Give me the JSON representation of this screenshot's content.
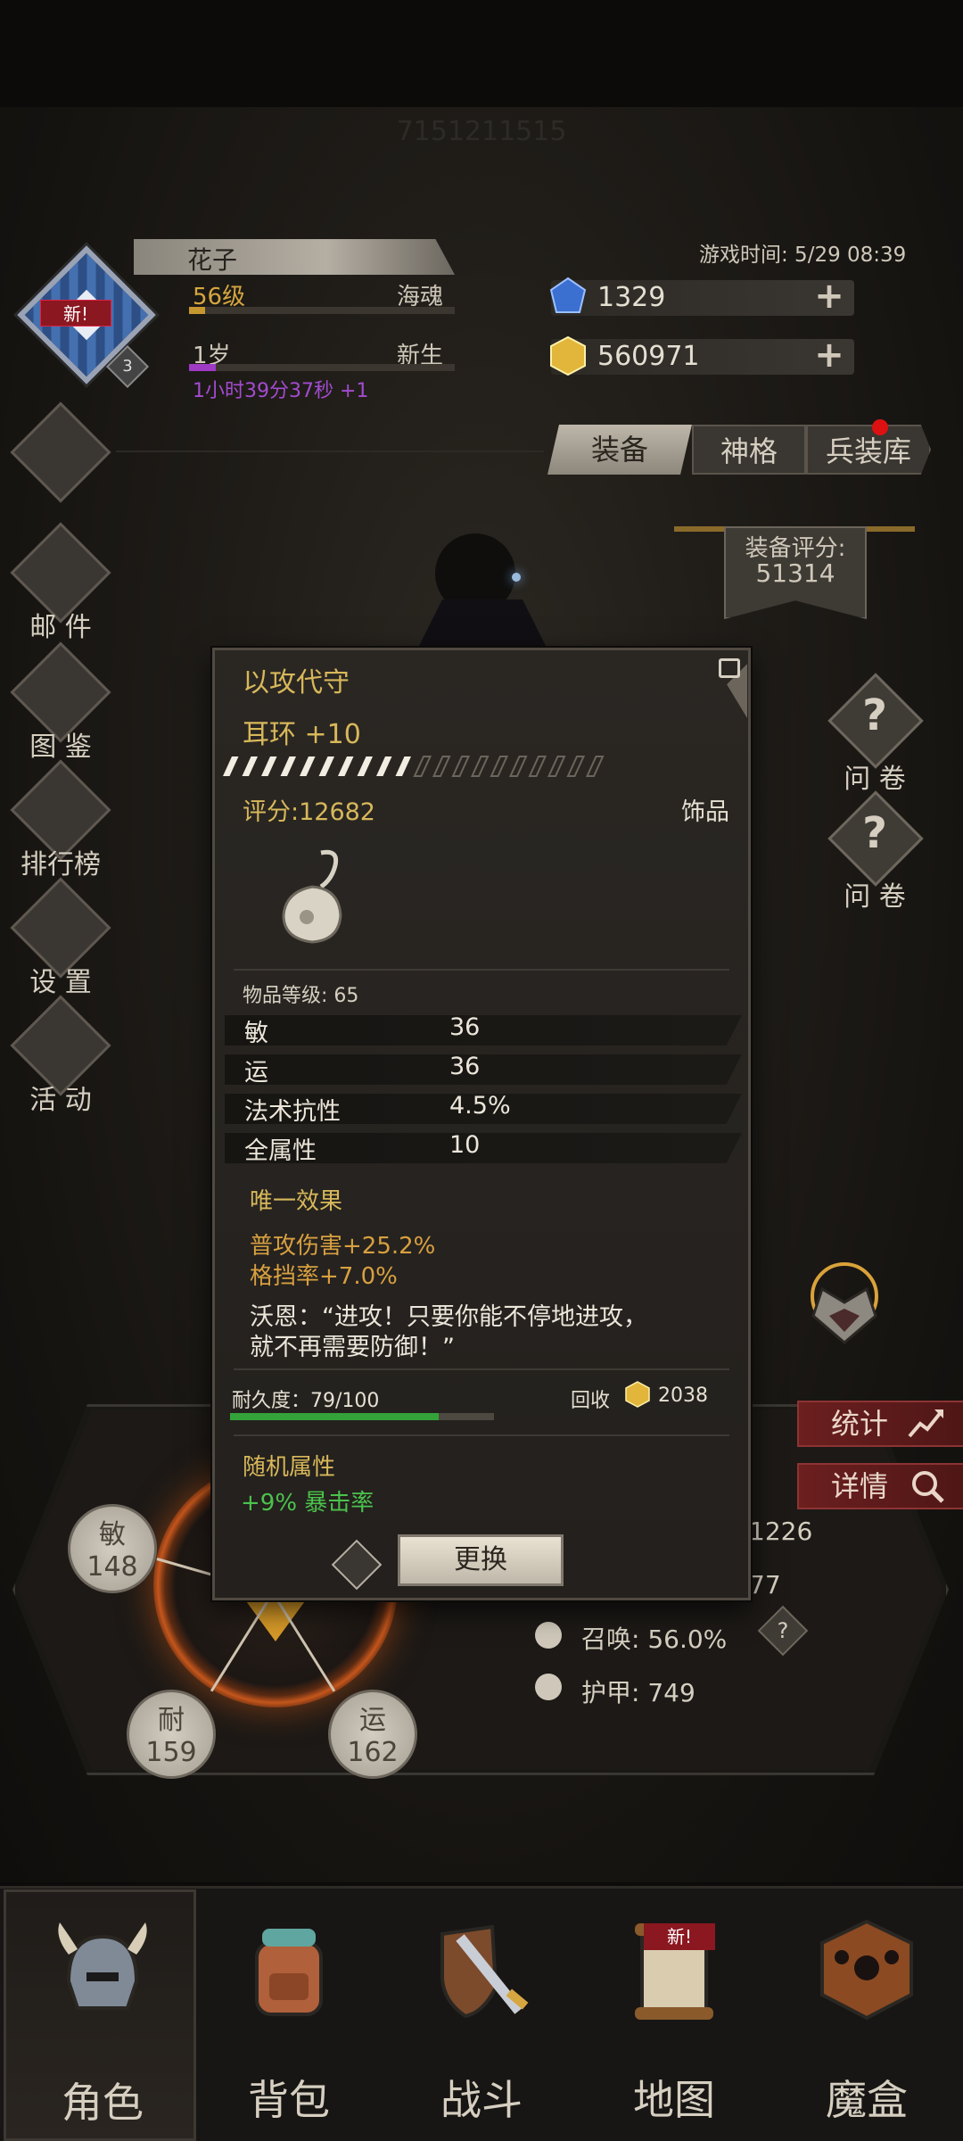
{
  "header": {
    "uid": "7151211515",
    "game_time": "游戏时间: 5/29 08:39"
  },
  "player": {
    "new_tag": "新!",
    "avatar_level": "3",
    "name": "花子",
    "level": "56级",
    "class_name": "海魂",
    "age": "1岁",
    "age_stage": "新生",
    "timer": "1小时39分37秒 +1",
    "level_progress": 0.06,
    "age_progress": 0.1
  },
  "currency": {
    "gems": "1329",
    "gold": "560971",
    "gem_color": "#3b6fd0",
    "gold_color": "#e2b53b"
  },
  "side_menu": {
    "mail": "邮 件",
    "codex": "图 鉴",
    "ranking": "排行榜",
    "settings": "设 置",
    "events": "活 动"
  },
  "tabs": {
    "equip": "装备",
    "divine": "神格",
    "armory": "兵装库"
  },
  "equip_score": {
    "label": "装备评分:",
    "value": "51314"
  },
  "quests": [
    {
      "q": "?",
      "label": "问 卷"
    },
    {
      "q": "?",
      "label": "问 卷"
    }
  ],
  "tooltip": {
    "title": "以攻代守",
    "item_type": "耳环 +10",
    "score": "评分:12682",
    "category": "饰品",
    "item_level": "物品等级: 65",
    "enhance_filled": 10,
    "enhance_total": 20,
    "props": [
      {
        "name": "敏",
        "value": "36"
      },
      {
        "name": "运",
        "value": "36"
      },
      {
        "name": "法术抗性",
        "value": "4.5%"
      },
      {
        "name": "全属性",
        "value": "10"
      }
    ],
    "unique_header": "唯一效果",
    "unique_1": "普攻伤害+25.2%",
    "unique_2": "格挡率+7.0%",
    "quote_1": "沃恩：“进攻！只要你能不停地进攻，",
    "quote_2": "就不再需要防御！”",
    "durability": "耐久度：79/100",
    "durability_fraction": 0.79,
    "recycle_label": "回收",
    "recycle_value": "2038",
    "random_header": "随机属性",
    "random_1": "+9%  暴击率",
    "swap_button": "更换"
  },
  "stats_panel": {
    "attrs": [
      {
        "name": "敏",
        "value": "148"
      },
      {
        "name": "耐",
        "value": "159"
      },
      {
        "name": "运",
        "value": "162"
      }
    ],
    "partial_1": "1226",
    "partial_2": "77",
    "summon": "召唤: 56.0%",
    "armor": "护甲: 749",
    "help": "?",
    "stat_button": "统计",
    "detail_button": "详情"
  },
  "bottom_nav": [
    {
      "label": "角色",
      "active": true
    },
    {
      "label": "背包",
      "active": false
    },
    {
      "label": "战斗",
      "active": false
    },
    {
      "label": "地图",
      "active": false,
      "badge": "新!"
    },
    {
      "label": "魔盒",
      "active": false
    }
  ]
}
